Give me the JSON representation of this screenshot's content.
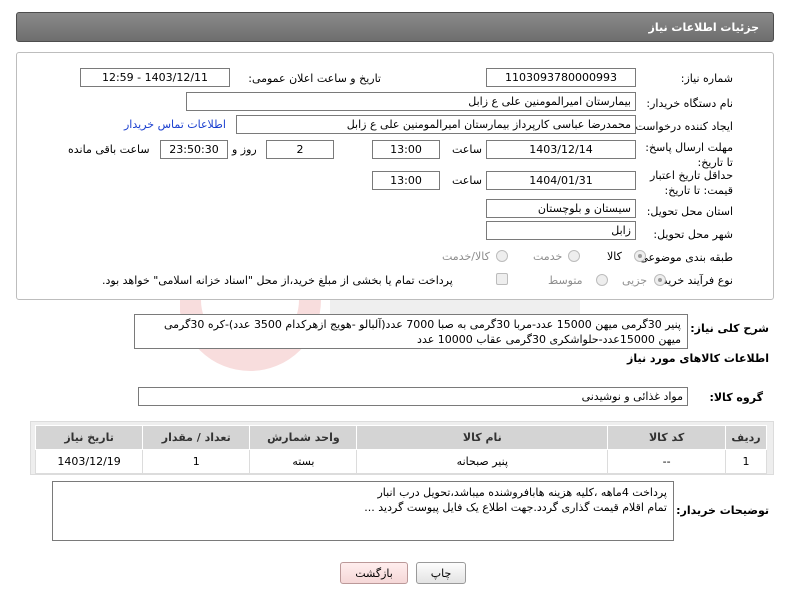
{
  "header": {
    "title": "جزئیات اطلاعات نیاز"
  },
  "need_number": {
    "label": "شماره نیاز:",
    "value": "1103093780000993"
  },
  "announce_datetime": {
    "label": "تاریخ و ساعت اعلان عمومی:",
    "value": "1403/12/11 - 12:59"
  },
  "buyer_org": {
    "label": "نام دستگاه خریدار:",
    "value": "بیمارستان امیرالمومنین علی  ع  زابل"
  },
  "requester": {
    "label": "ایجاد کننده درخواست:",
    "value": "محمدرضا عباسی کارپرداز بیمارستان امیرالمومنین علی  ع  زابل",
    "contact_link": "اطلاعات تماس خریدار"
  },
  "reply_deadline": {
    "label": "مهلت ارسال پاسخ: تا تاریخ:",
    "date": "1403/12/14",
    "time_label": "ساعت",
    "time": "13:00",
    "days": "2",
    "days_label": "روز و",
    "remaining": "23:50:30",
    "remaining_label": "ساعت باقی مانده"
  },
  "price_validity": {
    "label": "حداقل تاریخ اعتبار قیمت: تا تاریخ:",
    "date": "1404/01/31",
    "time_label": "ساعت",
    "time": "13:00"
  },
  "delivery_province": {
    "label": "استان محل تحویل:",
    "value": "سیستان و بلوچستان"
  },
  "delivery_city": {
    "label": "شهر محل تحویل:",
    "value": "زابل"
  },
  "category": {
    "label": "طبقه بندی موضوعی:",
    "options": [
      "کالا",
      "خدمت",
      "کالا/خدمت"
    ],
    "selected": "کالا"
  },
  "purchase_process": {
    "label": "نوع فرآیند خرید :",
    "options": [
      "جزیی",
      "متوسط"
    ],
    "selected": "جزیی",
    "payment_note": "پرداخت تمام یا بخشی از مبلغ خرید،از محل \"اسناد خزانه اسلامی\" خواهد بود."
  },
  "general_description": {
    "label": "شرح کلی نیاز:",
    "line1": "پنیر 30گرمی میهن 15000 عدد-مربا 30گرمی به صبا 7000 عدد(آلبالو -هویج ازهرکدام 3500 عدد)-کره 30گرمی",
    "line2": "میهن 15000عدد-حلواشکری 30گرمی عقاب 10000 عدد"
  },
  "goods_info": {
    "title": "اطلاعات کالاهای مورد نیاز",
    "group_label": "گروه کالا:",
    "group_value": "مواد غذائی و نوشیدنی"
  },
  "items_table": {
    "headers": [
      "ردیف",
      "کد کالا",
      "نام کالا",
      "واحد شمارش",
      "تعداد / مقدار",
      "تاریخ نیاز"
    ],
    "rows": [
      {
        "row": "1",
        "code": "--",
        "name": "پنیر صبحانه",
        "unit": "بسته",
        "qty": "1",
        "date": "1403/12/19"
      }
    ]
  },
  "buyer_notes": {
    "label": "توضیحات خریدار:",
    "line1": "پرداخت 4ماهه ،کلیه هزینه هابافروشنده میباشد،تحویل درب انبار",
    "line2": "تمام اقلام قیمت گذاری گردد.جهت اطلاع یک فایل پیوست گردید ..."
  },
  "buttons": {
    "print": "چاپ",
    "back": "بازگشت"
  }
}
